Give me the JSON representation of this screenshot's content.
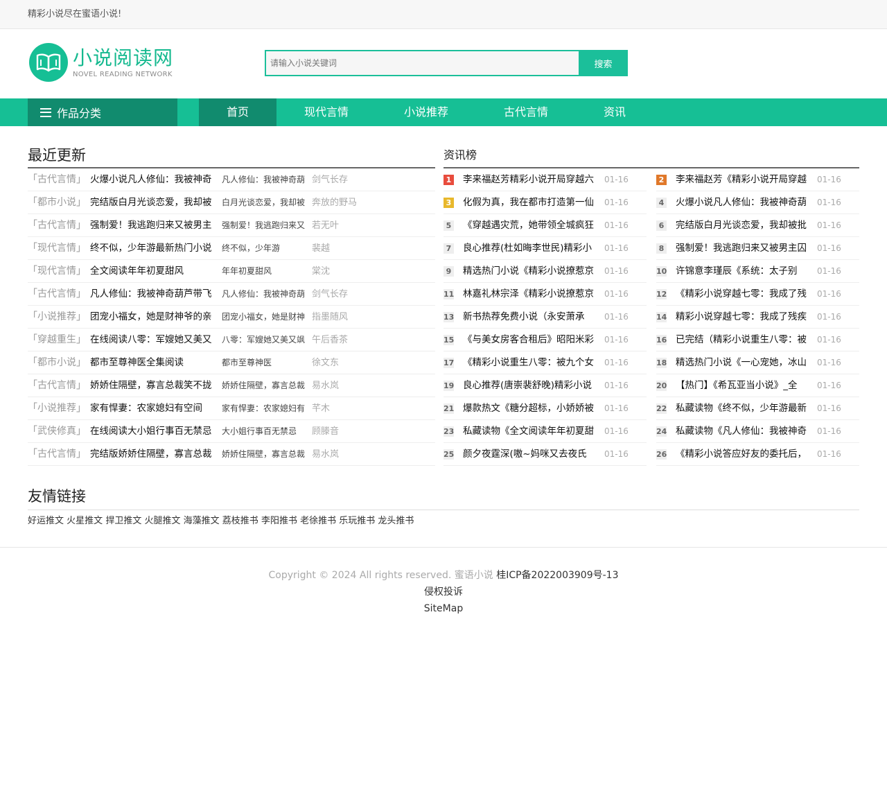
{
  "topbar": {
    "text": "精彩小说尽在蜜语小说!"
  },
  "logo": {
    "cn": "小说阅读网",
    "en": "NOVEL READING NETWORK"
  },
  "search": {
    "placeholder": "请输入小说关键词",
    "button": "搜索"
  },
  "nav": {
    "category_label": "作品分类",
    "items": [
      {
        "label": "首页"
      },
      {
        "label": "现代言情"
      },
      {
        "label": "小说推荐"
      },
      {
        "label": "古代言情"
      },
      {
        "label": "资讯"
      }
    ]
  },
  "updates": {
    "title": "最近更新",
    "rows": [
      {
        "cat": "「古代言情」",
        "title": "火爆小说凡人修仙：我被神奇",
        "chapter": "凡人修仙：我被神奇葫",
        "author": "剑气长存"
      },
      {
        "cat": "「都市小说」",
        "title": "完结版白月光谈恋爱，我却被",
        "chapter": "白月光谈恋爱，我却被",
        "author": "奔放的野马"
      },
      {
        "cat": "「古代言情」",
        "title": "强制爱！我逃跑归来又被男主",
        "chapter": "强制爱！我逃跑归来又",
        "author": "若无叶"
      },
      {
        "cat": "「现代言情」",
        "title": "终不似，少年游最新热门小说",
        "chapter": "终不似，少年游",
        "author": "裴越"
      },
      {
        "cat": "「现代言情」",
        "title": "全文阅读年年初夏甜风",
        "chapter": "年年初夏甜风",
        "author": "棠沈"
      },
      {
        "cat": "「古代言情」",
        "title": "凡人修仙：我被神奇葫芦带飞",
        "chapter": "凡人修仙：我被神奇葫",
        "author": "剑气长存"
      },
      {
        "cat": "「小说推荐」",
        "title": "团宠小福女，她是财神爷的亲",
        "chapter": "团宠小福女，她是财神",
        "author": "指墨随风"
      },
      {
        "cat": "「穿越重生」",
        "title": "在线阅读八零：军嫂她又美又",
        "chapter": "八零：军嫂她又美又飒",
        "author": "午后香茶"
      },
      {
        "cat": "「都市小说」",
        "title": "都市至尊神医全集阅读",
        "chapter": "都市至尊神医",
        "author": "徐文东"
      },
      {
        "cat": "「古代言情」",
        "title": "娇娇住隔壁，寡言总裁笑不拢",
        "chapter": "娇娇住隔壁，寡言总裁",
        "author": "易水岚"
      },
      {
        "cat": "「小说推荐」",
        "title": "家有悍妻：农家媳妇有空间",
        "chapter": "家有悍妻：农家媳妇有",
        "author": "芊木"
      },
      {
        "cat": "「武侠修真」",
        "title": "在线阅读大小姐行事百无禁忌",
        "chapter": "大小姐行事百无禁忌",
        "author": "顾滕音"
      },
      {
        "cat": "「古代言情」",
        "title": "完结版娇娇住隔壁，寡言总裁",
        "chapter": "娇娇住隔壁，寡言总裁",
        "author": "易水岚"
      }
    ]
  },
  "ranking": {
    "title": "资讯榜",
    "badge_colors": {
      "1": "#e84c3d",
      "2": "#e0782a",
      "3": "#e8b82c"
    },
    "left": [
      {
        "num": "1",
        "title": "李来福赵芳精彩小说开局穿越六",
        "date": "01-16"
      },
      {
        "num": "3",
        "title": "化假为真，我在都市打造第一仙",
        "date": "01-16"
      },
      {
        "num": "5",
        "title": "《穿越遇灾荒，她带领全城疯狂",
        "date": "01-16"
      },
      {
        "num": "7",
        "title": "良心推荐(杜如晦李世民)精彩小",
        "date": "01-16"
      },
      {
        "num": "9",
        "title": "精选热门小说《精彩小说撩惹京",
        "date": "01-16"
      },
      {
        "num": "11",
        "title": "林嘉礼林宗泽《精彩小说撩惹京",
        "date": "01-16"
      },
      {
        "num": "13",
        "title": "新书热荐免费小说（永安萧承",
        "date": "01-16"
      },
      {
        "num": "15",
        "title": "《与美女房客合租后》昭阳米彩",
        "date": "01-16"
      },
      {
        "num": "17",
        "title": "《精彩小说重生八零：被九个女",
        "date": "01-16"
      },
      {
        "num": "19",
        "title": "良心推荐(唐崇裴舒晚)精彩小说",
        "date": "01-16"
      },
      {
        "num": "21",
        "title": "爆款热文《糖分超标，小娇娇被",
        "date": "01-16"
      },
      {
        "num": "23",
        "title": "私藏读物《全文阅读年年初夏甜",
        "date": "01-16"
      },
      {
        "num": "25",
        "title": "颜夕夜霆深(嗷~妈咪又去夜氏",
        "date": "01-16"
      }
    ],
    "right": [
      {
        "num": "2",
        "title": "李来福赵芳《精彩小说开局穿越",
        "date": "01-16"
      },
      {
        "num": "4",
        "title": "火爆小说凡人修仙：我被神奇葫",
        "date": "01-16"
      },
      {
        "num": "6",
        "title": "完结版白月光谈恋爱，我却被批",
        "date": "01-16"
      },
      {
        "num": "8",
        "title": "强制爱！我逃跑归来又被男主囚",
        "date": "01-16"
      },
      {
        "num": "10",
        "title": "许锦意李瑾辰《系统：太子别",
        "date": "01-16"
      },
      {
        "num": "12",
        "title": "《精彩小说穿越七零：我成了残",
        "date": "01-16"
      },
      {
        "num": "14",
        "title": "精彩小说穿越七零：我成了残疾",
        "date": "01-16"
      },
      {
        "num": "16",
        "title": "已完结（精彩小说重生八零：被",
        "date": "01-16"
      },
      {
        "num": "18",
        "title": "精选热门小说《一心宠她，冰山",
        "date": "01-16"
      },
      {
        "num": "20",
        "title": "【热门】《希瓦亚当小说》_全",
        "date": "01-16"
      },
      {
        "num": "22",
        "title": "私藏读物《终不似，少年游最新",
        "date": "01-16"
      },
      {
        "num": "24",
        "title": "私藏读物《凡人修仙：我被神奇",
        "date": "01-16"
      },
      {
        "num": "26",
        "title": "《精彩小说答应好友的委托后，",
        "date": "01-16"
      }
    ]
  },
  "links": {
    "title": "友情链接",
    "items": [
      "好运推文",
      "火星推文",
      "捍卫推文",
      "火腿推文",
      "海藻推文",
      "荔枝推书",
      "李阳推书",
      "老徐推书",
      "乐玩推书",
      "龙头推书"
    ]
  },
  "footer": {
    "copyright": "Copyright © 2024 All rights reserved. 蜜语小说",
    "icp": "桂ICP备2022003909号-13",
    "complaint": "侵权投诉",
    "sitemap": "SiteMap"
  }
}
